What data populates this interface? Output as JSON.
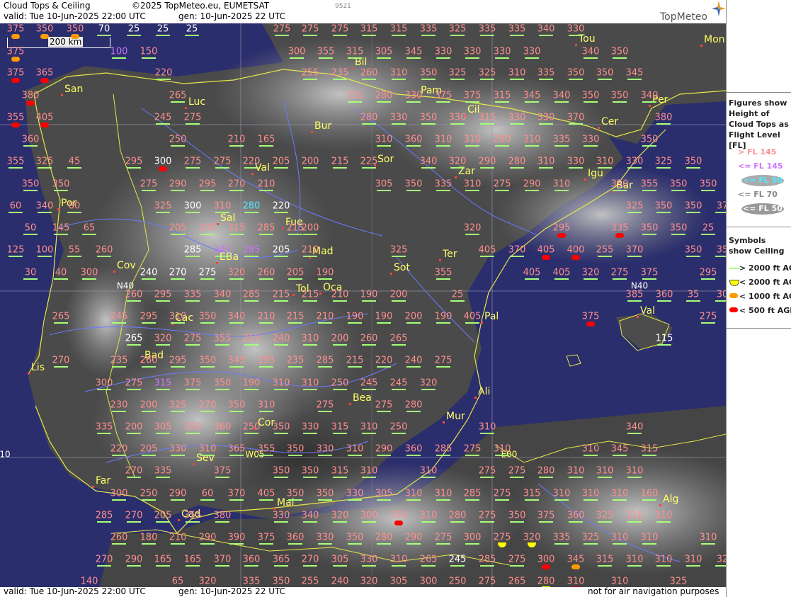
{
  "header": {
    "product": "Cloud Tops & Ceiling",
    "copyright": "©2025 TopMeteo.eu, EUMETSAT",
    "valid": "valid:  Tue  10-Jun-2025  22:00 UTC",
    "gen": "gen: 10-Jun-2025 22 UTC",
    "code": "9521",
    "brand": "TopMeteo"
  },
  "scale": {
    "label": "200 km"
  },
  "footer": {
    "valid": "valid:  Tue  10-Jun-2025  22:00 UTC",
    "gen": "gen: 10-Jun-2025 22 UTC",
    "disclaimer": "not for air navigation purposes"
  },
  "legend": {
    "title": "Figures show Height of Cloud Tops as Flight Level [FL]",
    "levels": [
      "> FL 145",
      "<= FL 145",
      "<= FL 90",
      "<= FL 70",
      "<= FL 50"
    ],
    "level_colors": [
      "#ff8f8f",
      "#cc77ff",
      "#55e7ff",
      "#ffffff",
      "#ffffff"
    ],
    "symbols_title": "Symbols show Ceiling",
    "symbols": [
      "> 2000 ft AGL",
      "< 2000 ft AGL",
      "< 1000 ft AGL",
      "< 500 ft AGL"
    ],
    "symbol_colors": [
      "#a6ff78",
      "#ffff00",
      "#ff9a00",
      "#ff0000"
    ]
  },
  "graticule": [
    "N40",
    "N40",
    "W05",
    "E00",
    "10"
  ],
  "cities": [
    "Tou",
    "Mon",
    "Bil",
    "San",
    "Pam",
    "Luc",
    "Per",
    "Cil",
    "Cer",
    "Bur",
    "Sor",
    "Zar",
    "Val",
    "Igu",
    "Bar",
    "Por",
    "Sal",
    "Fue",
    "Mad",
    "Ter",
    "EBa",
    "Cov",
    "Sot",
    "Oca",
    "Tol",
    "Val",
    "Pal",
    "Cac",
    "Bad",
    "Lis",
    "Bea",
    "Ali",
    "Mur",
    "Cor",
    "Sev",
    "Far",
    "Mal",
    "Alg",
    "Cad"
  ],
  "values": [
    "375",
    "350",
    "350",
    "70",
    "25",
    "25",
    "25",
    "275",
    "275",
    "275",
    "315",
    "315",
    "335",
    "325",
    "335",
    "335",
    "340",
    "330",
    "375",
    "100",
    "150",
    "300",
    "355",
    "315",
    "305",
    "345",
    "330",
    "330",
    "330",
    "330",
    "340",
    "350",
    "375",
    "365",
    "220",
    "255",
    "235",
    "260",
    "310",
    "350",
    "325",
    "325",
    "310",
    "335",
    "350",
    "350",
    "345",
    "380",
    "265",
    "255",
    "280",
    "330",
    "375",
    "375",
    "315",
    "345",
    "340",
    "350",
    "350",
    "340",
    "355",
    "405",
    "245",
    "275",
    "280",
    "330",
    "350",
    "330",
    "315",
    "330",
    "330",
    "370",
    "380",
    "360",
    "250",
    "210",
    "165",
    "310",
    "360",
    "310",
    "310",
    "280",
    "310",
    "335",
    "330",
    "350",
    "355",
    "325",
    "45",
    "295",
    "300",
    "275",
    "275",
    "220",
    "205",
    "200",
    "215",
    "225",
    "340",
    "320",
    "290",
    "280",
    "310",
    "330",
    "310",
    "330",
    "325",
    "350",
    "350",
    "350",
    "275",
    "290",
    "295",
    "270",
    "210",
    "305",
    "350",
    "335",
    "310",
    "275",
    "290",
    "310",
    "350",
    "355",
    "350",
    "350",
    "60",
    "340",
    "80",
    "325",
    "300",
    "310",
    "280",
    "220",
    "325",
    "350",
    "350",
    "37",
    "50",
    "145",
    "65",
    "205",
    "295",
    "315",
    "285",
    "215",
    "200",
    "320",
    "295",
    "335",
    "350",
    "350",
    "25",
    "125",
    "100",
    "55",
    "260",
    "285",
    "345",
    "285",
    "205",
    "210",
    "325",
    "405",
    "370",
    "405",
    "400",
    "255",
    "370",
    "350",
    "35",
    "30",
    "40",
    "300",
    "240",
    "270",
    "275",
    "320",
    "260",
    "205",
    "190",
    "355",
    "405",
    "405",
    "320",
    "275",
    "375",
    "295",
    "260",
    "295",
    "335",
    "340",
    "285",
    "215",
    "215",
    "210",
    "190",
    "200",
    "25",
    "385",
    "360",
    "35",
    "30",
    "265",
    "245",
    "295",
    "310",
    "350",
    "340",
    "210",
    "215",
    "210",
    "190",
    "190",
    "200",
    "190",
    "405",
    "375",
    "275",
    "265",
    "320",
    "275",
    "355",
    "215",
    "240",
    "310",
    "200",
    "260",
    "265",
    "115",
    "270",
    "235",
    "260",
    "295",
    "350",
    "345",
    "195",
    "235",
    "285",
    "215",
    "220",
    "240",
    "275",
    "300",
    "275",
    "315",
    "375",
    "350",
    "190",
    "310",
    "310",
    "250",
    "245",
    "245",
    "320",
    "230",
    "200",
    "325",
    "270",
    "350",
    "310",
    "275",
    "275",
    "280",
    "335",
    "200",
    "305",
    "350",
    "360",
    "250",
    "350",
    "330",
    "315",
    "310",
    "250",
    "310",
    "340",
    "220",
    "205",
    "330",
    "310",
    "365",
    "355",
    "350",
    "330",
    "310",
    "290",
    "360",
    "285",
    "275",
    "310",
    "310",
    "345",
    "315",
    "270",
    "335",
    "375",
    "350",
    "350",
    "315",
    "310",
    "310",
    "275",
    "275",
    "280",
    "310",
    "310",
    "310",
    "300",
    "250",
    "290",
    "60",
    "370",
    "405",
    "350",
    "350",
    "330",
    "305",
    "310",
    "310",
    "285",
    "275",
    "315",
    "310",
    "310",
    "310",
    "160",
    "285",
    "270",
    "205",
    "355",
    "380",
    "330",
    "340",
    "320",
    "300",
    "310",
    "310",
    "280",
    "275",
    "350",
    "375",
    "360",
    "325",
    "310",
    "310",
    "260",
    "180",
    "210",
    "290",
    "390",
    "375",
    "360",
    "330",
    "350",
    "280",
    "290",
    "275",
    "300",
    "275",
    "320",
    "335",
    "325",
    "310",
    "310",
    "310",
    "270",
    "290",
    "165",
    "165",
    "370",
    "360",
    "365",
    "270",
    "305",
    "330",
    "310",
    "265",
    "245",
    "285",
    "275",
    "300",
    "345",
    "315",
    "310",
    "310",
    "310",
    "32",
    "140",
    "65",
    "320",
    "335",
    "350",
    "255",
    "240",
    "320",
    "305",
    "300",
    "250",
    "275",
    "265",
    "280",
    "310",
    "310",
    "325"
  ]
}
